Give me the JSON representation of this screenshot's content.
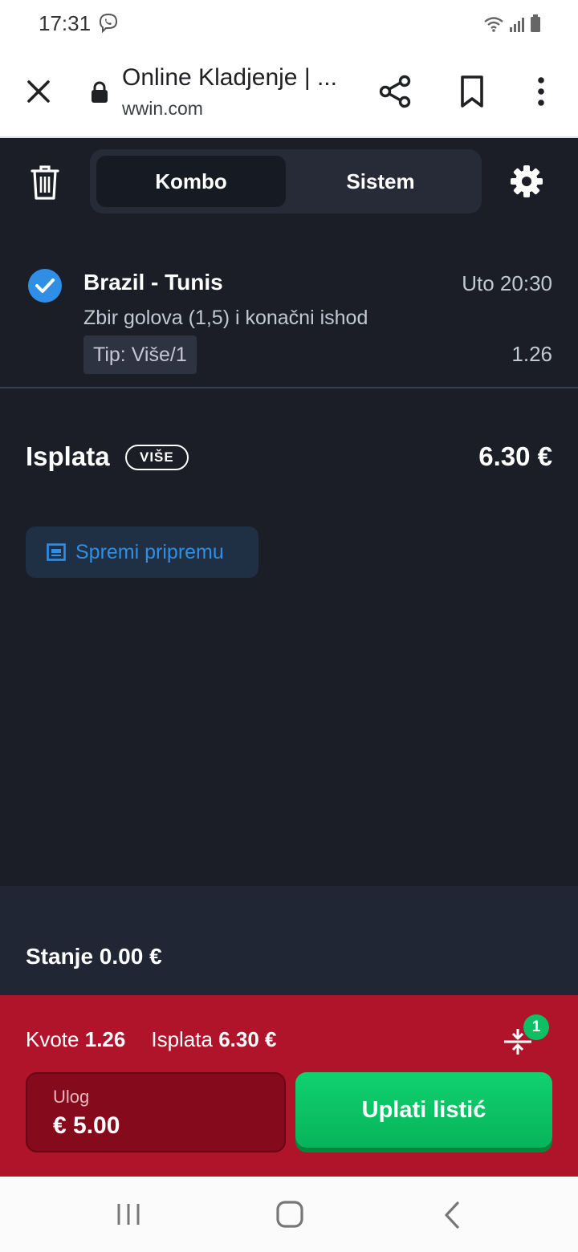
{
  "status_bar": {
    "time": "17:31"
  },
  "browser": {
    "title": "Online Kladjenje | ...",
    "url": "wwin.com"
  },
  "bet_type_tabs": [
    {
      "label": "Kombo",
      "active": true
    },
    {
      "label": "Sistem",
      "active": false
    }
  ],
  "selection": {
    "match": "Brazil - Tunis",
    "time": "Uto 20:30",
    "market": "Zbir golova (1,5) i konačni ishod",
    "tip": "Tip: Više/1",
    "odd": "1.26"
  },
  "payout": {
    "label": "Isplata",
    "badge": "VIŠE",
    "value": "6.30 €"
  },
  "save_draft": {
    "label": "Spremi pripremu"
  },
  "balance": {
    "text": "Stanje 0.00 €"
  },
  "summary": {
    "odds_label": "Kvote",
    "odds_value": "1.26",
    "payout_label": "Isplata",
    "payout_value": "6.30 €",
    "selection_count": "1"
  },
  "stake": {
    "label": "Ulog",
    "value": "€ 5.00"
  },
  "place_bet": {
    "label": "Uplati listić"
  },
  "colors": {
    "accent_blue": "#2f8fe6",
    "panel_red": "#b0142a",
    "cta_green": "#0fbf63",
    "background": "#1b1e27"
  }
}
